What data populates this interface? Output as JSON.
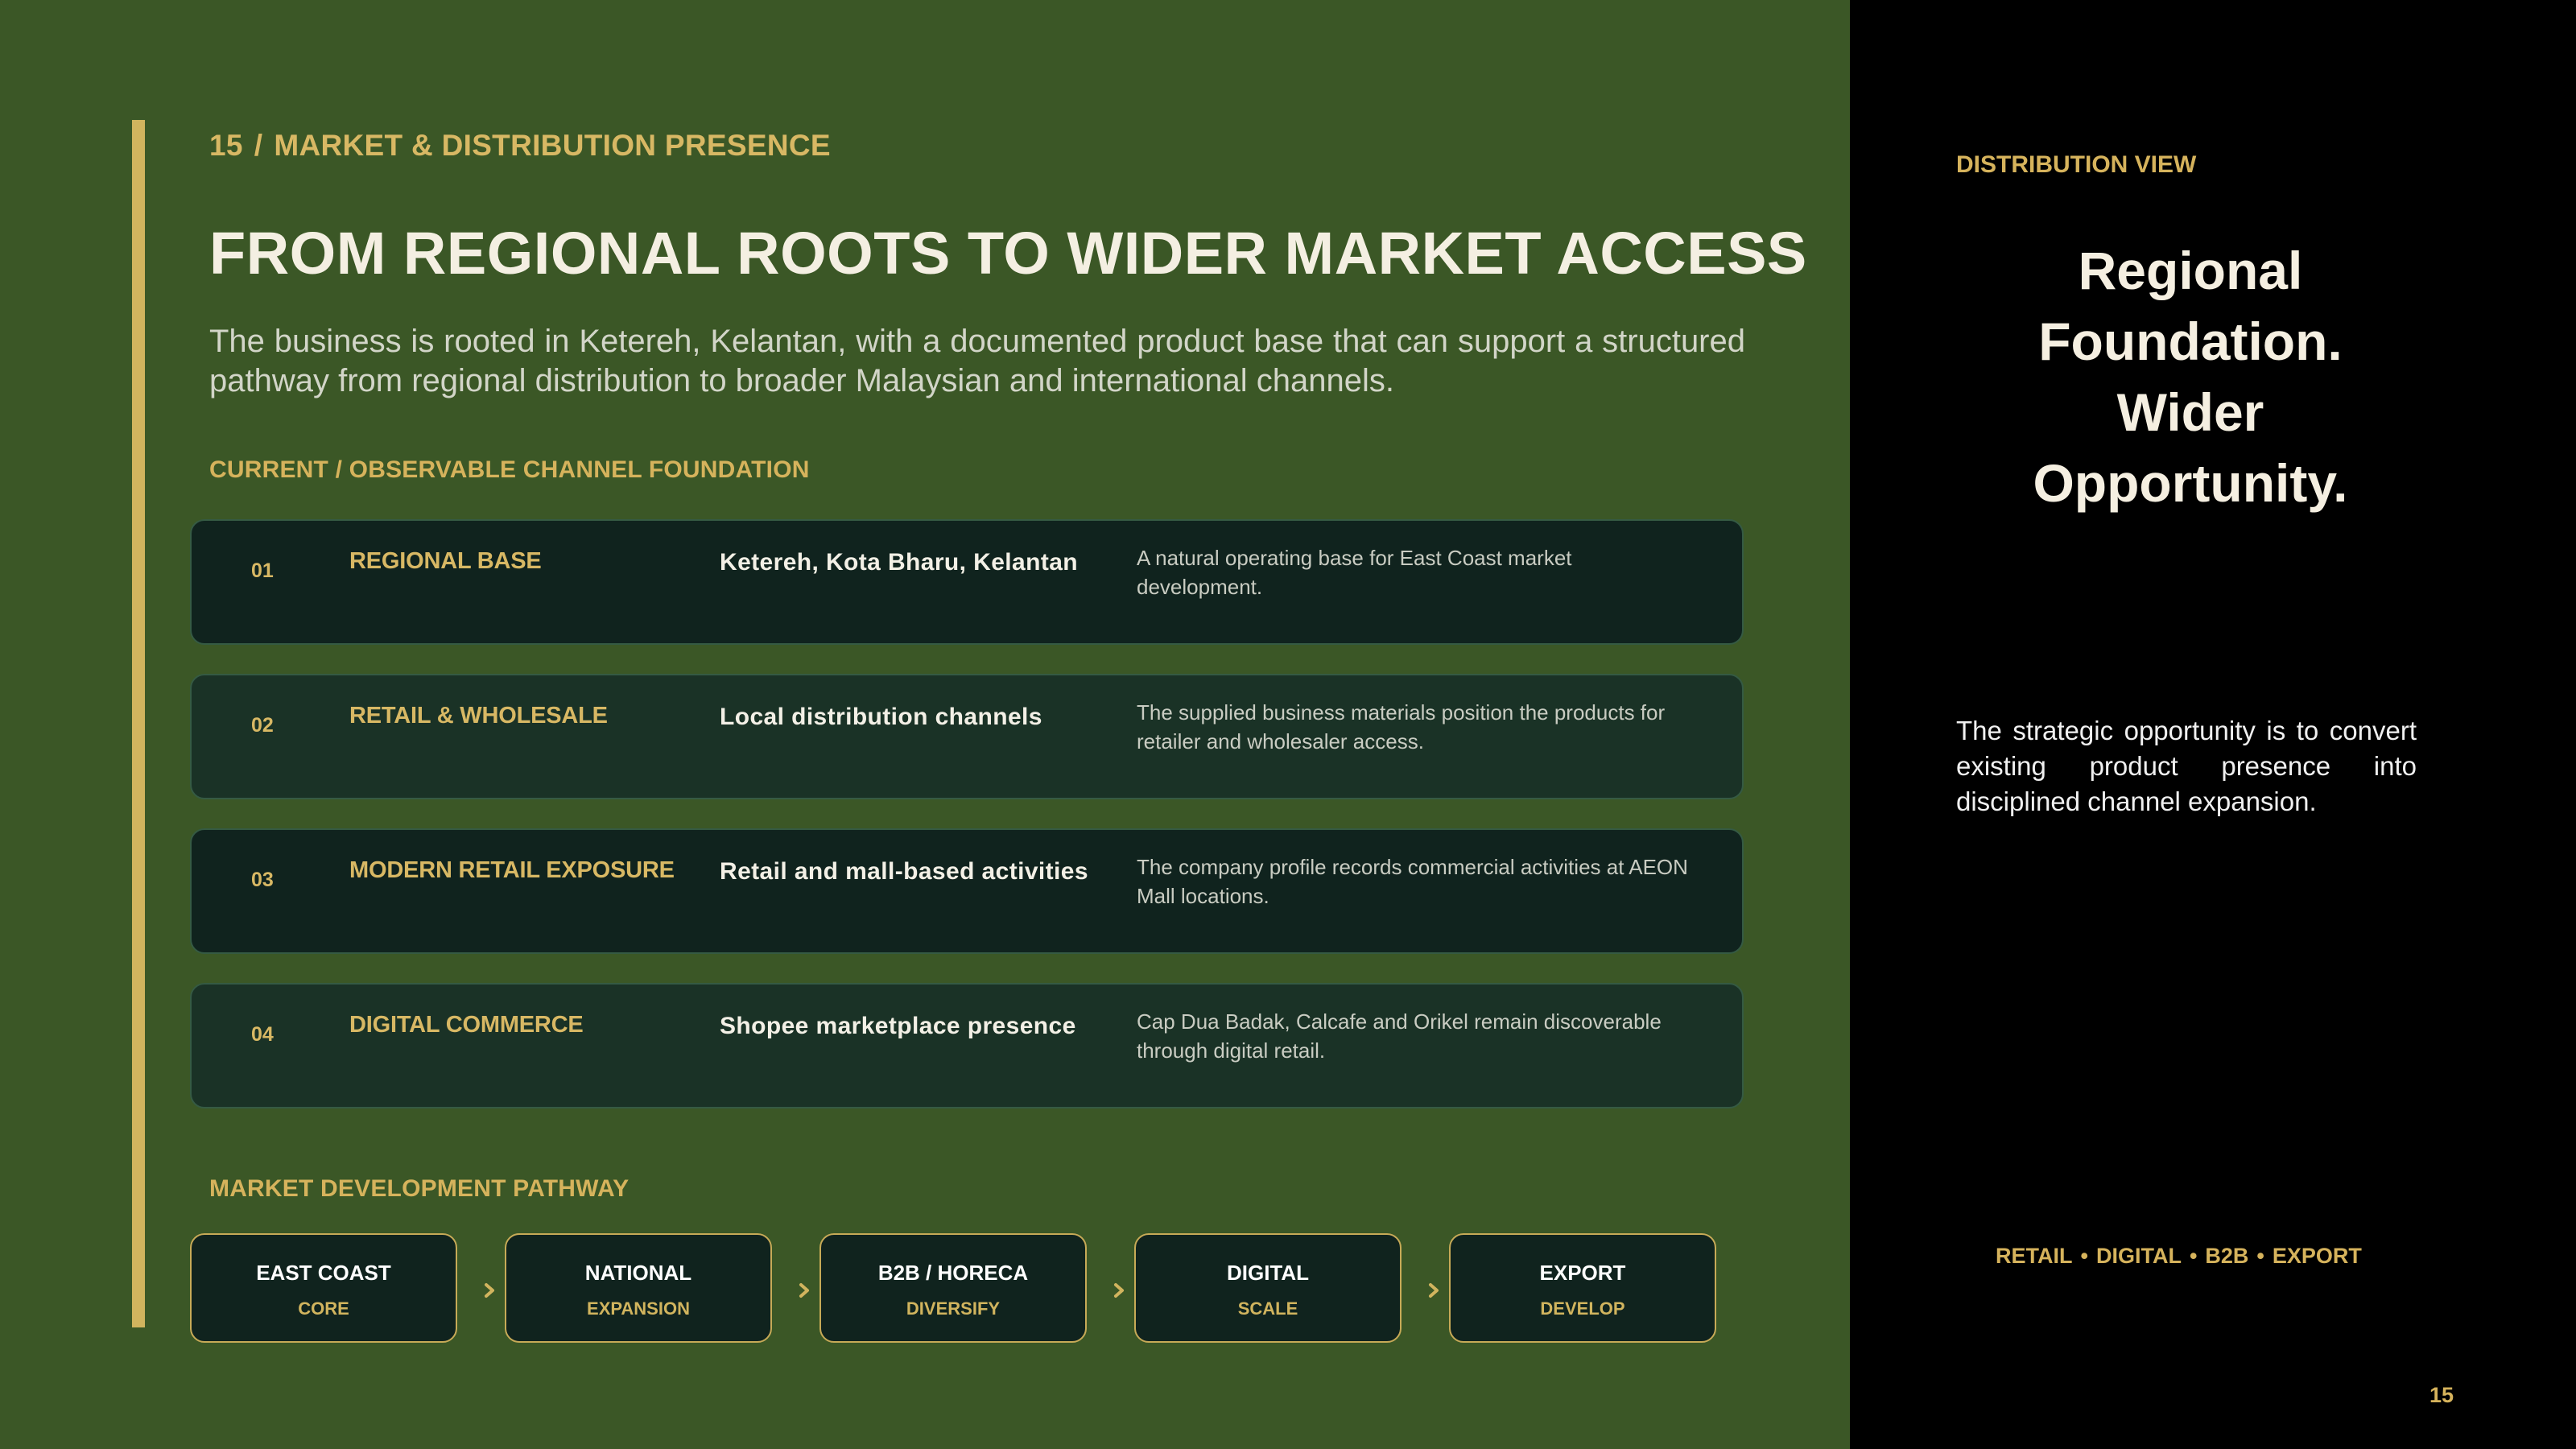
{
  "header": {
    "slide_number": "15",
    "separator": "/",
    "section": "MARKET & DISTRIBUTION PRESENCE",
    "title": "FROM REGIONAL ROOTS TO WIDER MARKET ACCESS",
    "lead": "The business is rooted in Ketereh, Kelantan, with a documented product base that can support a structured pathway from regional distribution to broader Malaysian and international channels."
  },
  "channels": {
    "label": "CURRENT / OBSERVABLE CHANNEL FOUNDATION",
    "rows": [
      {
        "num": "01",
        "category": "REGIONAL BASE",
        "channel": "Ketereh, Kota Bharu, Kelantan",
        "description": "A natural operating base for East Coast market development."
      },
      {
        "num": "02",
        "category": "RETAIL & WHOLESALE",
        "channel": "Local distribution channels",
        "description": "The supplied business materials position the products for retailer and wholesaler access."
      },
      {
        "num": "03",
        "category": "MODERN RETAIL EXPOSURE",
        "channel": "Retail and mall-based activities",
        "description": "The company profile records commercial activities at AEON Mall locations."
      },
      {
        "num": "04",
        "category": "DIGITAL COMMERCE",
        "channel": "Shopee marketplace presence",
        "description": "Cap Dua Badak, Calcafe and Orikel remain discoverable through digital retail."
      }
    ]
  },
  "pathway": {
    "label": "MARKET DEVELOPMENT PATHWAY",
    "steps": [
      {
        "title": "EAST COAST",
        "subtitle": "CORE"
      },
      {
        "title": "NATIONAL",
        "subtitle": "EXPANSION"
      },
      {
        "title": "B2B / HORECA",
        "subtitle": "DIVERSIFY"
      },
      {
        "title": "DIGITAL",
        "subtitle": "SCALE"
      },
      {
        "title": "EXPORT",
        "subtitle": "DEVELOP"
      }
    ]
  },
  "sidebar": {
    "label": "DISTRIBUTION VIEW",
    "headline_lines": [
      "Regional",
      "Foundation.",
      "Wider",
      "Opportunity."
    ],
    "body": "The strategic opportunity is to convert existing product presence into disciplined channel expansion.",
    "tags": [
      "RETAIL",
      "DIGITAL",
      "B2B",
      "EXPORT"
    ],
    "tag_separator": "•",
    "page_number": "15"
  },
  "colors": {
    "background_green": "#3b5726",
    "gold": "#d8b864",
    "dark_card": "#10231e",
    "mid_card": "#1a3226",
    "sidebar": "#000000"
  }
}
